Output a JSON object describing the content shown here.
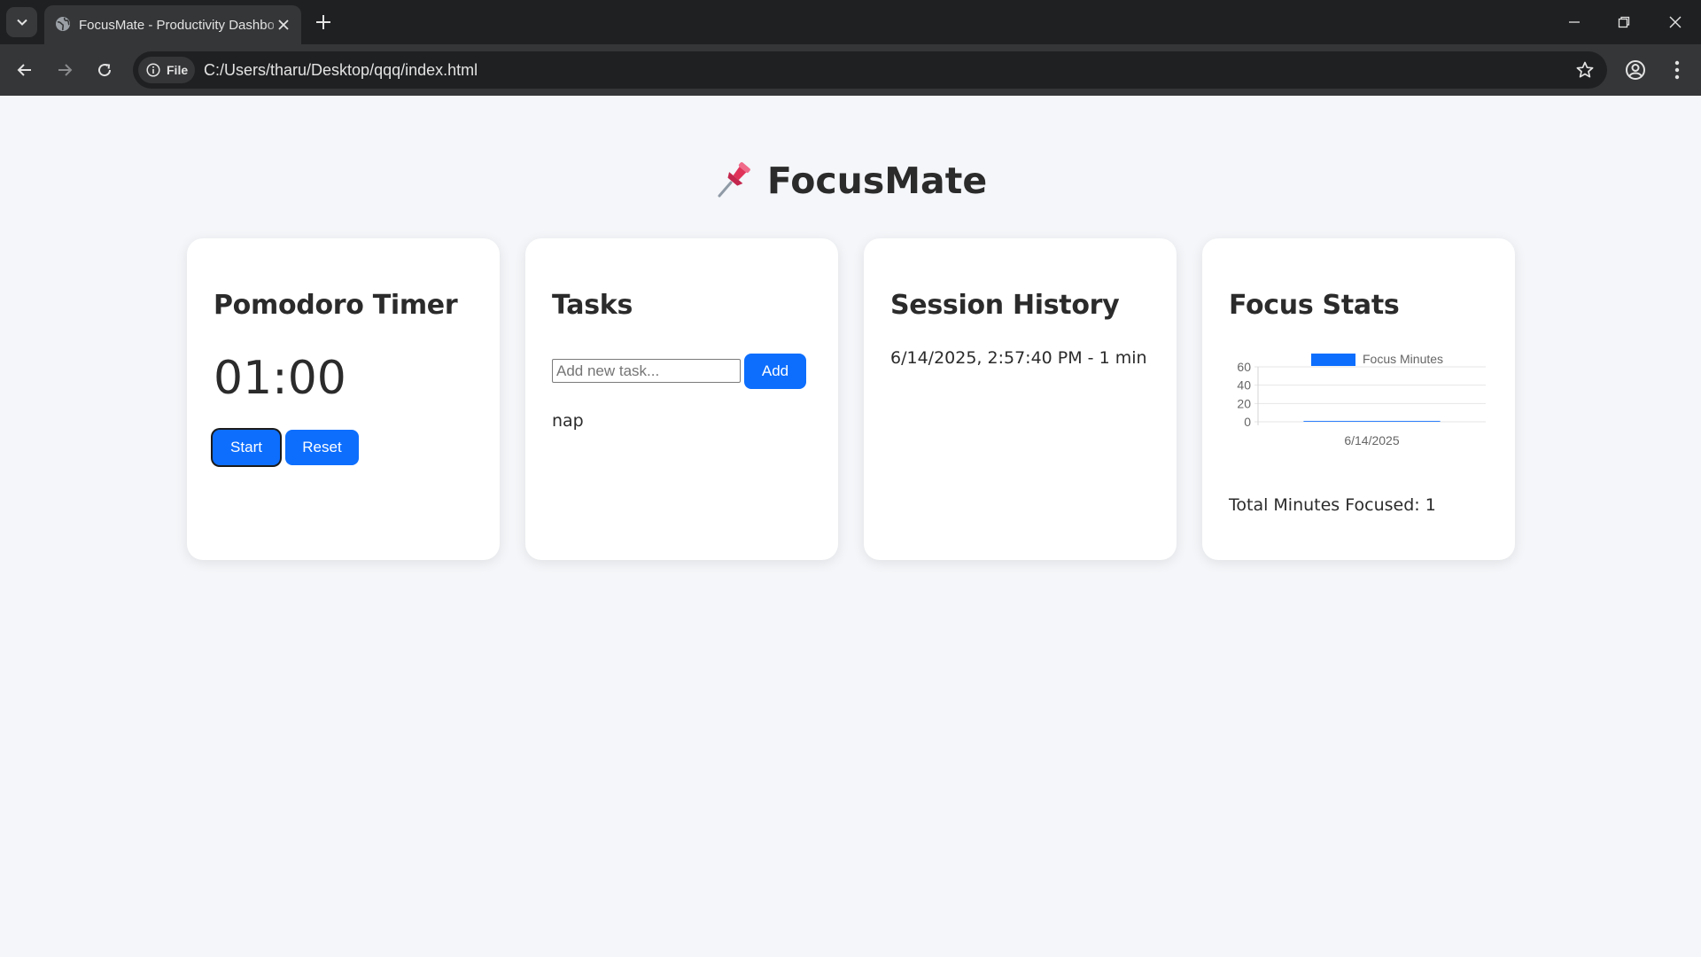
{
  "browser": {
    "tab_title": "FocusMate - Productivity Dashboard",
    "chip_label": "File",
    "url": "C:/Users/tharu/Desktop/qqq/index.html"
  },
  "app": {
    "title": "FocusMate",
    "title_icon": "pushpin-icon"
  },
  "timer_card": {
    "heading": "Pomodoro Timer",
    "time": "01:00",
    "start_label": "Start",
    "reset_label": "Reset"
  },
  "tasks_card": {
    "heading": "Tasks",
    "input_placeholder": "Add new task...",
    "add_label": "Add",
    "tasks": [
      "nap"
    ]
  },
  "history_card": {
    "heading": "Session History",
    "sessions": [
      "6/14/2025, 2:57:40 PM - 1 min"
    ]
  },
  "stats_card": {
    "heading": "Focus Stats",
    "total_text": "Total Minutes Focused: 1"
  },
  "colors": {
    "accent": "#0d6efd",
    "page_bg": "#f4f6f9",
    "card_bg": "#ffffff",
    "text": "#2b2b2b"
  },
  "chart_data": {
    "type": "bar",
    "categories": [
      "6/14/2025"
    ],
    "series": [
      {
        "name": "Focus Minutes",
        "values": [
          1
        ]
      }
    ],
    "yticks": [
      0,
      20,
      40,
      60
    ],
    "ylim": [
      0,
      60
    ],
    "legend": "top",
    "grid": true
  }
}
